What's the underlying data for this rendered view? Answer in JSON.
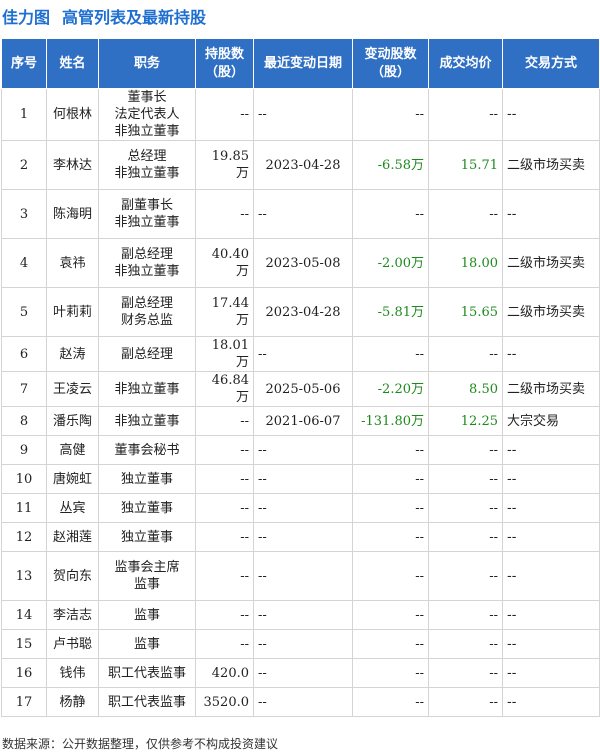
{
  "header": {
    "company": "佳力图",
    "title": "高管列表及最新持股"
  },
  "table": {
    "columns": [
      "序号",
      "姓名",
      "职务",
      "持股数\n（股）",
      "最近变动日期",
      "变动股数\n（股）",
      "成交均价",
      "交易方式"
    ],
    "rows": [
      {
        "idx": "1",
        "name": "何根林",
        "position": "董事长\n法定代表人\n非独立董事",
        "shares": "--",
        "date": "--",
        "change": "--",
        "price": "--",
        "type": "--",
        "tall": true
      },
      {
        "idx": "2",
        "name": "李林达",
        "position": "总经理\n非独立董事",
        "shares": "19.85万",
        "date": "2023-04-28",
        "change": "-6.58万",
        "price": "15.71",
        "type": "二级市场买卖",
        "tall": true
      },
      {
        "idx": "3",
        "name": "陈海明",
        "position": "副董事长\n非独立董事",
        "shares": "--",
        "date": "--",
        "change": "--",
        "price": "--",
        "type": "--",
        "tall": true
      },
      {
        "idx": "4",
        "name": "袁祎",
        "position": "副总经理\n非独立董事",
        "shares": "40.40万",
        "date": "2023-05-08",
        "change": "-2.00万",
        "price": "18.00",
        "type": "二级市场买卖",
        "tall": true
      },
      {
        "idx": "5",
        "name": "叶莉莉",
        "position": "副总经理\n财务总监",
        "shares": "17.44万",
        "date": "2023-04-28",
        "change": "-5.81万",
        "price": "15.65",
        "type": "二级市场买卖",
        "tall": true
      },
      {
        "idx": "6",
        "name": "赵涛",
        "position": "副总经理",
        "shares": "18.01万",
        "date": "--",
        "change": "--",
        "price": "--",
        "type": "--",
        "tall": false
      },
      {
        "idx": "7",
        "name": "王凌云",
        "position": "非独立董事",
        "shares": "46.84万",
        "date": "2025-05-06",
        "change": "-2.20万",
        "price": "8.50",
        "type": "二级市场买卖",
        "tall": false
      },
      {
        "idx": "8",
        "name": "潘乐陶",
        "position": "非独立董事",
        "shares": "--",
        "date": "2021-06-07",
        "change": "-131.80万",
        "price": "12.25",
        "type": "大宗交易",
        "tall": false
      },
      {
        "idx": "9",
        "name": "高健",
        "position": "董事会秘书",
        "shares": "--",
        "date": "--",
        "change": "--",
        "price": "--",
        "type": "--",
        "tall": false
      },
      {
        "idx": "10",
        "name": "唐婉虹",
        "position": "独立董事",
        "shares": "--",
        "date": "--",
        "change": "--",
        "price": "--",
        "type": "--",
        "tall": false
      },
      {
        "idx": "11",
        "name": "丛宾",
        "position": "独立董事",
        "shares": "--",
        "date": "--",
        "change": "--",
        "price": "--",
        "type": "--",
        "tall": false
      },
      {
        "idx": "12",
        "name": "赵湘莲",
        "position": "独立董事",
        "shares": "--",
        "date": "--",
        "change": "--",
        "price": "--",
        "type": "--",
        "tall": false
      },
      {
        "idx": "13",
        "name": "贺向东",
        "position": "监事会主席\n监事",
        "shares": "--",
        "date": "--",
        "change": "--",
        "price": "--",
        "type": "--",
        "tall": true
      },
      {
        "idx": "14",
        "name": "李洁志",
        "position": "监事",
        "shares": "--",
        "date": "--",
        "change": "--",
        "price": "--",
        "type": "--",
        "tall": false
      },
      {
        "idx": "15",
        "name": "卢书聪",
        "position": "监事",
        "shares": "--",
        "date": "--",
        "change": "--",
        "price": "--",
        "type": "--",
        "tall": false
      },
      {
        "idx": "16",
        "name": "钱伟",
        "position": "职工代表监事",
        "shares": "420.0",
        "date": "--",
        "change": "--",
        "price": "--",
        "type": "--",
        "tall": false
      },
      {
        "idx": "17",
        "name": "杨静",
        "position": "职工代表监事",
        "shares": "3520.0",
        "date": "--",
        "change": "--",
        "price": "--",
        "type": "--",
        "tall": false
      }
    ]
  },
  "footer": {
    "source": "数据来源：公开数据整理，仅供参考不构成投资建议"
  },
  "colors": {
    "header_bg": "#2f6fc4",
    "title": "#1f6fd1",
    "change_value": "#1e8a1e"
  }
}
